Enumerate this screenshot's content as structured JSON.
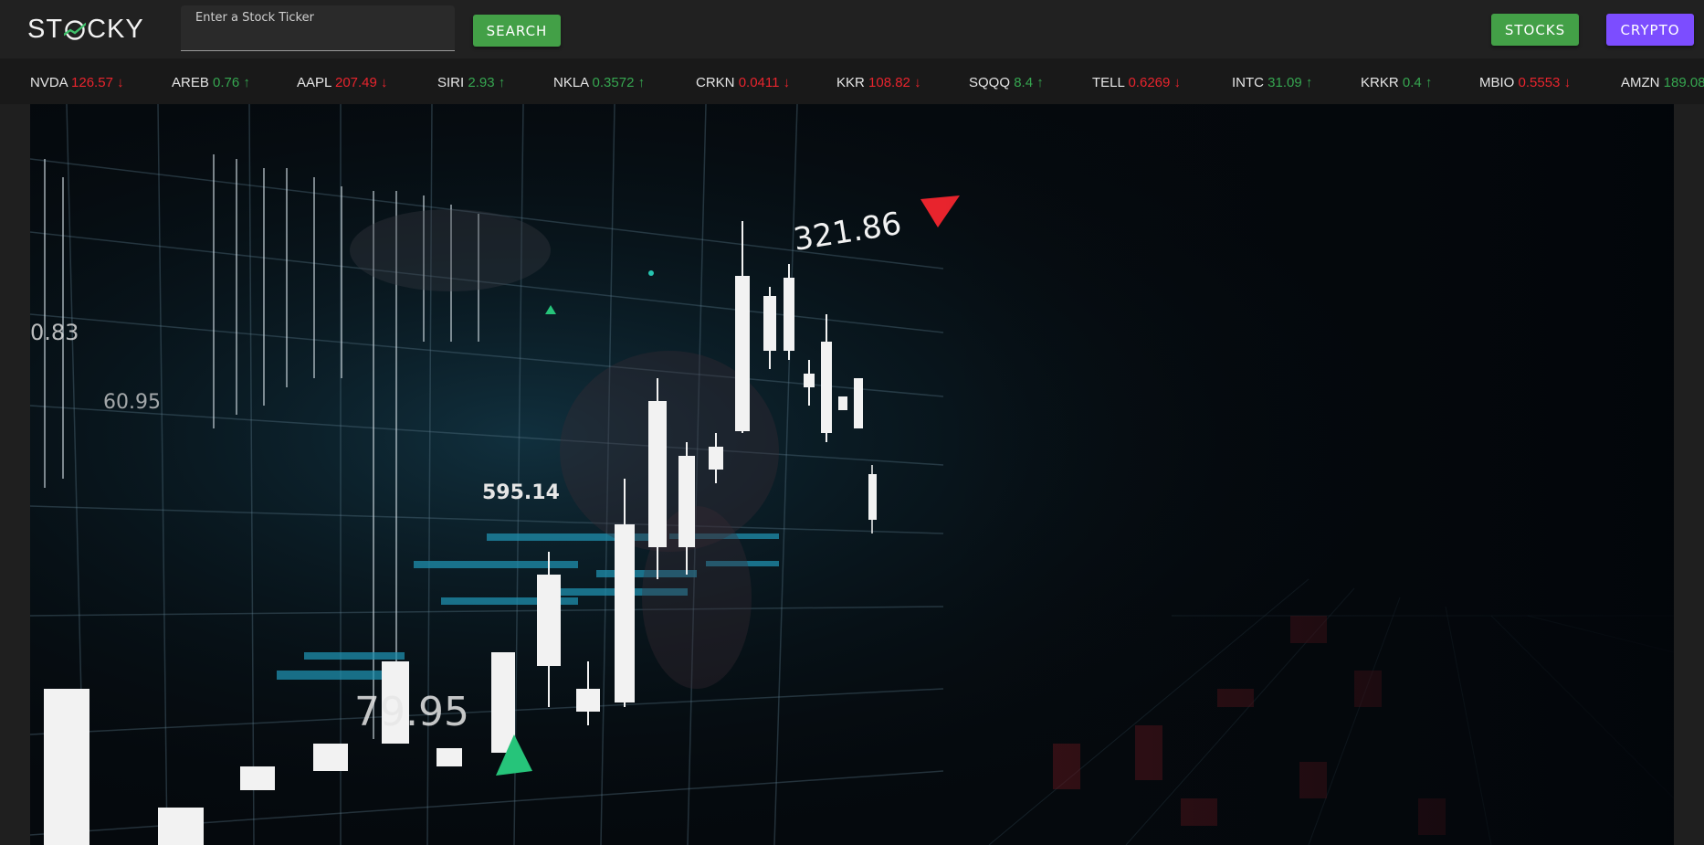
{
  "header": {
    "logo_text_left": "ST",
    "logo_text_right": "CKY",
    "search": {
      "label": "Enter a Stock Ticker",
      "value": ""
    },
    "search_button": "SEARCH",
    "nav": {
      "stocks": "STOCKS",
      "crypto": "CRYPTO"
    }
  },
  "colors": {
    "green": "#43a047",
    "purple": "#7c4dff",
    "down": "#e8242d",
    "up": "#36a650"
  },
  "ticker": [
    {
      "symbol": "NVDA",
      "price": "126.57",
      "dir": "down",
      "arrow": "↓"
    },
    {
      "symbol": "AREB",
      "price": "0.76",
      "dir": "up",
      "arrow": "↑"
    },
    {
      "symbol": "AAPL",
      "price": "207.49",
      "dir": "down",
      "arrow": "↓"
    },
    {
      "symbol": "SIRI",
      "price": "2.93",
      "dir": "up",
      "arrow": "↑"
    },
    {
      "symbol": "NKLA",
      "price": "0.3572",
      "dir": "up",
      "arrow": "↑"
    },
    {
      "symbol": "CRKN",
      "price": "0.0411",
      "dir": "down",
      "arrow": "↓"
    },
    {
      "symbol": "KKR",
      "price": "108.82",
      "dir": "down",
      "arrow": "↓"
    },
    {
      "symbol": "SQQQ",
      "price": "8.4",
      "dir": "up",
      "arrow": "↑"
    },
    {
      "symbol": "TELL",
      "price": "0.6269",
      "dir": "down",
      "arrow": "↓"
    },
    {
      "symbol": "INTC",
      "price": "31.09",
      "dir": "up",
      "arrow": "↑"
    },
    {
      "symbol": "KRKR",
      "price": "0.4",
      "dir": "up",
      "arrow": "↑"
    },
    {
      "symbol": "MBIO",
      "price": "0.5553",
      "dir": "down",
      "arrow": "↓"
    },
    {
      "symbol": "AMZN",
      "price": "189.08",
      "dir": "up",
      "arrow": ""
    }
  ],
  "hero": {
    "image_text": [
      "321.86",
      "595.14",
      "79.95",
      "0.83",
      "60.95"
    ]
  }
}
